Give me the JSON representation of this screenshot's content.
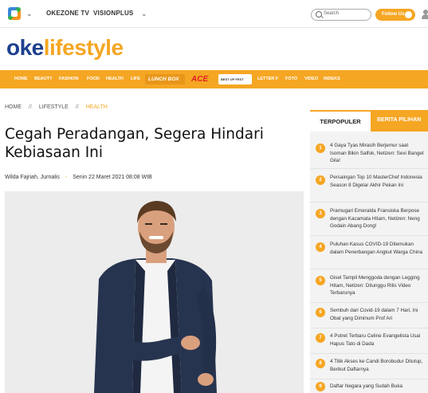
{
  "topbar": {
    "links": [
      "OKEZONE TV",
      "VISIONPLUS"
    ],
    "search_placeholder": "Search",
    "follow_label": "Follow Us"
  },
  "brand": {
    "part1": "oke",
    "part2": "lifestyle"
  },
  "nav": {
    "items": [
      "HOME",
      "BEAUTY",
      "FASHION",
      "FOOD",
      "HEALTH",
      "LIFE",
      "LETTER F",
      "FOTO",
      "VIDEO",
      "INDEKS"
    ],
    "promo1": "LUNCH BOX",
    "promo2": "ACE",
    "promo3": "BEST UP FEST"
  },
  "breadcrumb": {
    "home": "HOME",
    "section": "LIFESTYLE",
    "current": "HEALTH",
    "separator": "//"
  },
  "article": {
    "title": "Cegah Peradangan, Segera Hindari Kebiasaan Ini",
    "author": "Wilda Fajriah, Jurnalis",
    "date": "Senin 22 Maret 2021 08:08 WIB"
  },
  "sidebar": {
    "tab_active": "TERPOPULER",
    "tab_other": "BERITA PILIHAN",
    "items": [
      {
        "num": "1",
        "text": "4 Gaya Tyas Mirasih Berjemur saat Isoman Bikin Salfok, Netizen: Sexi Banget Gila!"
      },
      {
        "num": "2",
        "text": "Persaingan Top 10 MasterChef Indonesia Season 8 Digelar Akhir Pekan Ini"
      },
      {
        "num": "3",
        "text": "Pramugari Emeralda Fransiska Berpose dengan Kacamata Hitam, Netizen: Neng Godain Abang Dong!"
      },
      {
        "num": "4",
        "text": "Puluhan Kasus COVID-19 Ditemukan dalam Penerbangan Angkut Warga China"
      },
      {
        "num": "5",
        "text": "Gisel Tampil Menggoda dengan Legging Hitam, Netizen: Ditunggu Rilis Video Terbarunya"
      },
      {
        "num": "6",
        "text": "Sembuh dari Covid-19 dalam 7 Hari, Ini Obat yang Diminum Prof Ari"
      },
      {
        "num": "7",
        "text": "4 Potret Terbaru Celine Evangelista Usai Hapus Tato di Dada"
      },
      {
        "num": "8",
        "text": "4 Titik Akses ke Candi Borobudur Ditutup, Berikut Daftarnya"
      },
      {
        "num": "9",
        "text": "Daftar Negara yang Sudah Buka"
      }
    ]
  },
  "colors": {
    "brand_blue": "#1d3f8f",
    "accent_orange": "#f5a623"
  }
}
